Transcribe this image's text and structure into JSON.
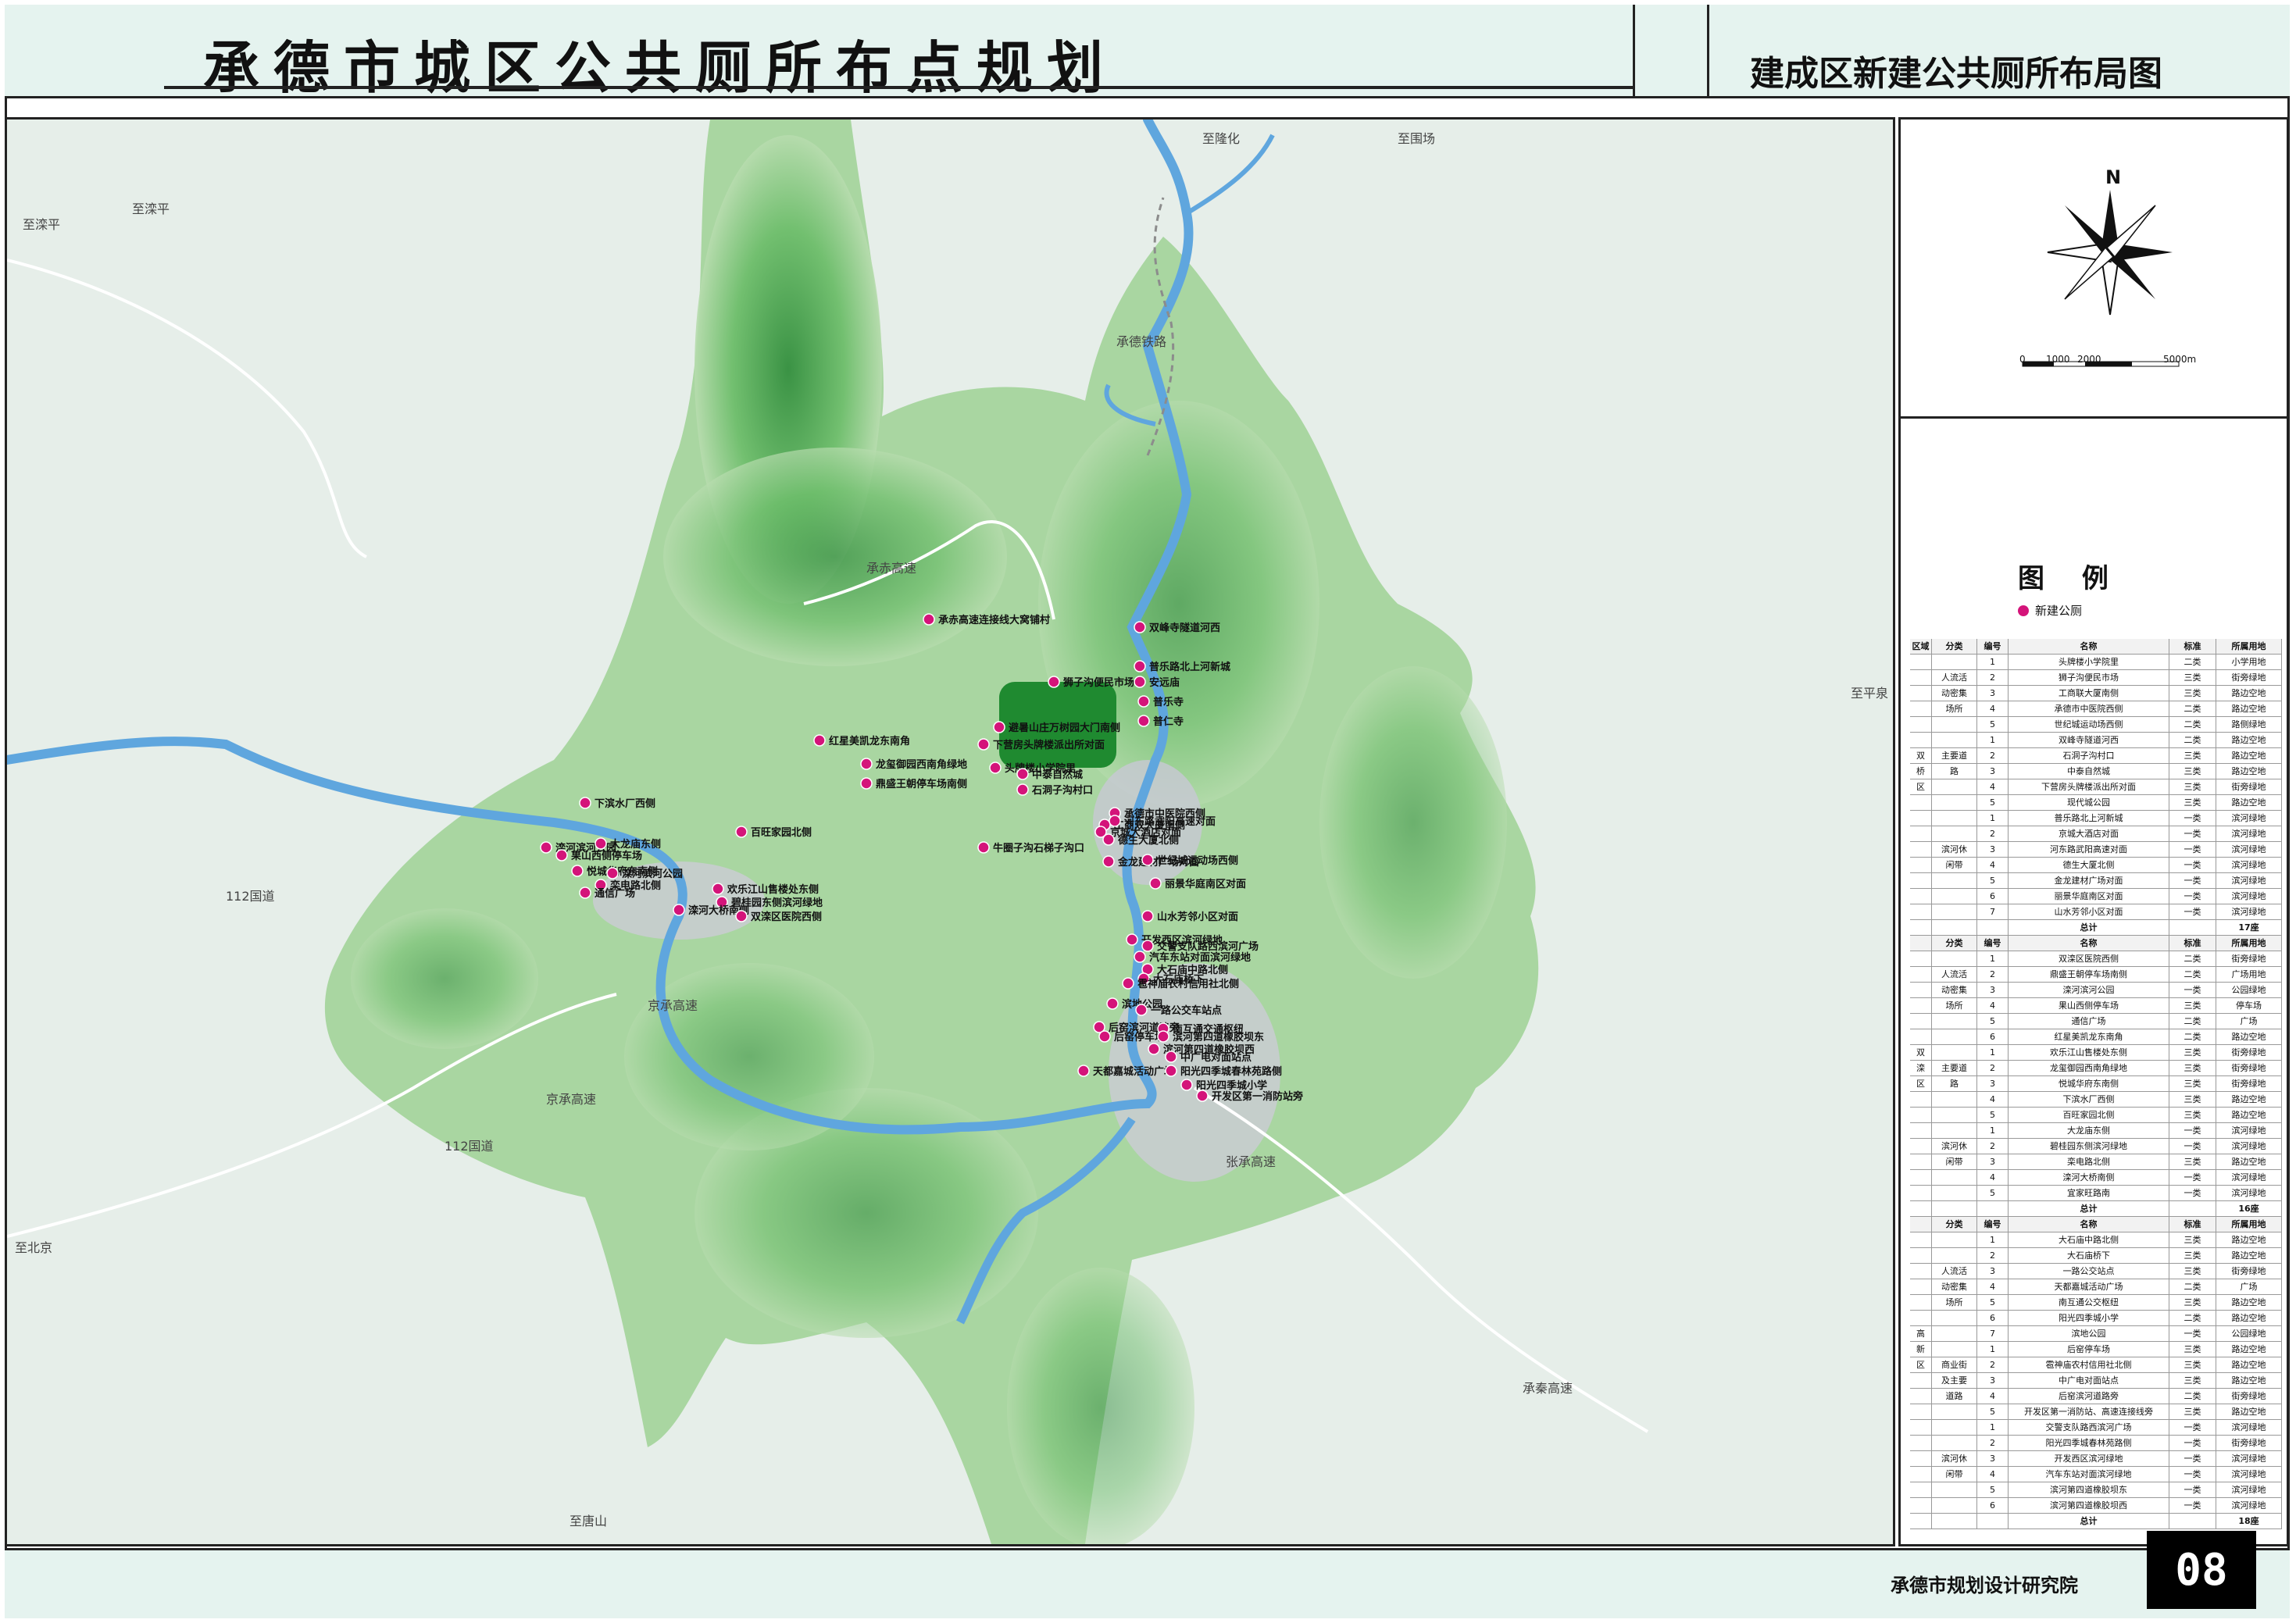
{
  "header": {
    "title": "承德市城区公共厕所布点规划",
    "subtitle": "建成区新建公共厕所布局图"
  },
  "footer": {
    "institute": "承德市规划设计研究院",
    "page_number": "08"
  },
  "compass": {
    "north": "N",
    "scale_labels": [
      "0",
      "1000",
      "2000",
      "5000m"
    ]
  },
  "legend": {
    "title": "图 例",
    "item_label": "新建公厕",
    "dot_color": "#d4147a"
  },
  "map": {
    "road_labels": [
      "至滦平",
      "至滦平",
      "至隆化",
      "至围场",
      "至平泉",
      "至北京",
      "至唐山",
      "京承高速",
      "承赤高速",
      "112国道",
      "112国道",
      "京承高速",
      "承德铁路",
      "张承高速",
      "承秦高速"
    ],
    "toilet_labels": [
      "承赤高速连接线大窝铺村",
      "双峰寺隧道河西",
      "普乐路北上河新城",
      "狮子沟便民市场",
      "安远庙",
      "普乐寺",
      "普仁寺",
      "避暑山庄万树园大门南侧",
      "下营房头牌楼派出所对面",
      "头牌楼小学院里",
      "中泰自然城",
      "石洞子沟村口",
      "红星美凯龙东南角",
      "龙玺御园西南角绿地",
      "鼎盛王朝停车场南侧",
      "工商双大厦南侧",
      "承德市中医院西侧",
      "河东路武阳高速对面",
      "京城大酒店对面",
      "德生大厦北侧",
      "牛圈子沟石梯子沟口",
      "金龙建材广场对面",
      "世纪城运动场西侧",
      "丽景华庭南区对面",
      "山水芳邻小区对面",
      "开发西区滨河绿地",
      "交警支队路西滨河广场",
      "汽车东站对面滨河绿地",
      "大石庙中路北侧",
      "大石庙桥下",
      "雹神庙农村信用社北侧",
      "滨地公园",
      "一路公交车站点",
      "后窑滨河道路旁",
      "后窑停车场",
      "南互通交通枢纽",
      "滨河第四道橡胶坝东",
      "滨河第四道橡胶坝西",
      "中广电对面站点",
      "天都嘉城活动广场",
      "阳光四季城春林苑路侧",
      "阳光四季城小学",
      "开发区第一消防站旁",
      "下滨水厂西侧",
      "百旺家园北侧",
      "滦河滨河公园",
      "大龙庙东侧",
      "果山西侧停车场",
      "悦城华府东南侧",
      "滦河滨河公园",
      "栾电路北侧",
      "通信广场",
      "欢乐江山售楼处东侧",
      "碧桂园东侧滨河绿地",
      "滦河大桥南侧",
      "双滦区医院西侧"
    ]
  },
  "table": {
    "headers": [
      "区域",
      "分类",
      "编号",
      "名称",
      "标准",
      "所属用地"
    ],
    "rows": [
      [
        "",
        "",
        "1",
        "头牌楼小学院里",
        "二类",
        "小学用地"
      ],
      [
        "",
        "人流活",
        "2",
        "狮子沟便民市场",
        "三类",
        "街旁绿地"
      ],
      [
        "",
        "动密集",
        "3",
        "工商联大厦南侧",
        "三类",
        "路边空地"
      ],
      [
        "",
        "场所",
        "4",
        "承德市中医院西侧",
        "二类",
        "路边空地"
      ],
      [
        "",
        "",
        "5",
        "世纪城运动场西侧",
        "二类",
        "路侧绿地"
      ],
      [
        "",
        "",
        "1",
        "双峰寺隧道河西",
        "二类",
        "路边空地"
      ],
      [
        "双",
        "主要道",
        "2",
        "石洞子沟村口",
        "三类",
        "路边空地"
      ],
      [
        "桥",
        "路",
        "3",
        "中泰自然城",
        "三类",
        "路边空地"
      ],
      [
        "区",
        "",
        "4",
        "下营房头牌楼派出所对面",
        "三类",
        "街旁绿地"
      ],
      [
        "",
        "",
        "5",
        "现代城公园",
        "三类",
        "路边空地"
      ],
      [
        "",
        "",
        "1",
        "普乐路北上河新城",
        "一类",
        "滨河绿地"
      ],
      [
        "",
        "",
        "2",
        "京城大酒店对面",
        "一类",
        "滨河绿地"
      ],
      [
        "",
        "滨河休",
        "3",
        "河东路武阳高速对面",
        "一类",
        "滨河绿地"
      ],
      [
        "",
        "闲带",
        "4",
        "德生大厦北侧",
        "一类",
        "滨河绿地"
      ],
      [
        "",
        "",
        "5",
        "金龙建材广场对面",
        "一类",
        "滨河绿地"
      ],
      [
        "",
        "",
        "6",
        "丽景华庭南区对面",
        "一类",
        "滨河绿地"
      ],
      [
        "",
        "",
        "7",
        "山水芳邻小区对面",
        "一类",
        "滨河绿地"
      ],
      [
        "",
        "",
        "",
        "总计",
        "",
        "17座"
      ],
      [
        "",
        "分类",
        "编号",
        "名称",
        "标准",
        "所属用地"
      ],
      [
        "",
        "",
        "1",
        "双滦区医院西侧",
        "二类",
        "街旁绿地"
      ],
      [
        "",
        "人流活",
        "2",
        "鼎盛王朝停车场南侧",
        "二类",
        "广场用地"
      ],
      [
        "",
        "动密集",
        "3",
        "滦河滨河公园",
        "一类",
        "公园绿地"
      ],
      [
        "",
        "场所",
        "4",
        "果山西侧停车场",
        "三类",
        "停车场"
      ],
      [
        "",
        "",
        "5",
        "通信广场",
        "二类",
        "广场"
      ],
      [
        "",
        "",
        "6",
        "红星美凯龙东南角",
        "二类",
        "路边空地"
      ],
      [
        "双",
        "",
        "1",
        "欢乐江山售楼处东侧",
        "三类",
        "街旁绿地"
      ],
      [
        "滦",
        "主要道",
        "2",
        "龙玺御园西南角绿地",
        "三类",
        "街旁绿地"
      ],
      [
        "区",
        "路",
        "3",
        "悦城华府东南侧",
        "三类",
        "街旁绿地"
      ],
      [
        "",
        "",
        "4",
        "下滨水厂西侧",
        "三类",
        "路边空地"
      ],
      [
        "",
        "",
        "5",
        "百旺家园北侧",
        "三类",
        "路边空地"
      ],
      [
        "",
        "",
        "1",
        "大龙庙东侧",
        "一类",
        "滨河绿地"
      ],
      [
        "",
        "滨河休",
        "2",
        "碧桂园东侧滨河绿地",
        "一类",
        "滨河绿地"
      ],
      [
        "",
        "闲带",
        "3",
        "栾电路北侧",
        "三类",
        "路边空地"
      ],
      [
        "",
        "",
        "4",
        "滦河大桥南侧",
        "一类",
        "滨河绿地"
      ],
      [
        "",
        "",
        "5",
        "宜家旺路南",
        "一类",
        "滨河绿地"
      ],
      [
        "",
        "",
        "",
        "总计",
        "",
        "16座"
      ],
      [
        "",
        "分类",
        "编号",
        "名称",
        "标准",
        "所属用地"
      ],
      [
        "",
        "",
        "1",
        "大石庙中路北侧",
        "三类",
        "路边空地"
      ],
      [
        "",
        "",
        "2",
        "大石庙桥下",
        "三类",
        "路边空地"
      ],
      [
        "",
        "人流活",
        "3",
        "一路公交站点",
        "三类",
        "街旁绿地"
      ],
      [
        "",
        "动密集",
        "4",
        "天都嘉城活动广场",
        "二类",
        "广场"
      ],
      [
        "",
        "场所",
        "5",
        "南互通公交枢纽",
        "三类",
        "路边空地"
      ],
      [
        "",
        "",
        "6",
        "阳光四季城小学",
        "二类",
        "路边空地"
      ],
      [
        "高",
        "",
        "7",
        "滨地公园",
        "一类",
        "公园绿地"
      ],
      [
        "新",
        "",
        "1",
        "后窑停车场",
        "三类",
        "路边空地"
      ],
      [
        "区",
        "商业街",
        "2",
        "雹神庙农村信用社北侧",
        "三类",
        "路边空地"
      ],
      [
        "",
        "及主要",
        "3",
        "中广电对面站点",
        "三类",
        "路边空地"
      ],
      [
        "",
        "道路",
        "4",
        "后窑滨河道路旁",
        "二类",
        "街旁绿地"
      ],
      [
        "",
        "",
        "5",
        "开发区第一消防站、高速连接线旁",
        "三类",
        "路边空地"
      ],
      [
        "",
        "",
        "1",
        "交警支队路西滨河广场",
        "一类",
        "滨河绿地"
      ],
      [
        "",
        "",
        "2",
        "阳光四季城春林苑路侧",
        "一类",
        "街旁绿地"
      ],
      [
        "",
        "滨河休",
        "3",
        "开发西区滨河绿地",
        "一类",
        "滨河绿地"
      ],
      [
        "",
        "闲带",
        "4",
        "汽车东站对面滨河绿地",
        "一类",
        "滨河绿地"
      ],
      [
        "",
        "",
        "5",
        "滨河第四道橡胶坝东",
        "一类",
        "滨河绿地"
      ],
      [
        "",
        "",
        "6",
        "滨河第四道橡胶坝西",
        "一类",
        "滨河绿地"
      ],
      [
        "",
        "",
        "",
        "总计",
        "",
        "18座"
      ]
    ]
  }
}
